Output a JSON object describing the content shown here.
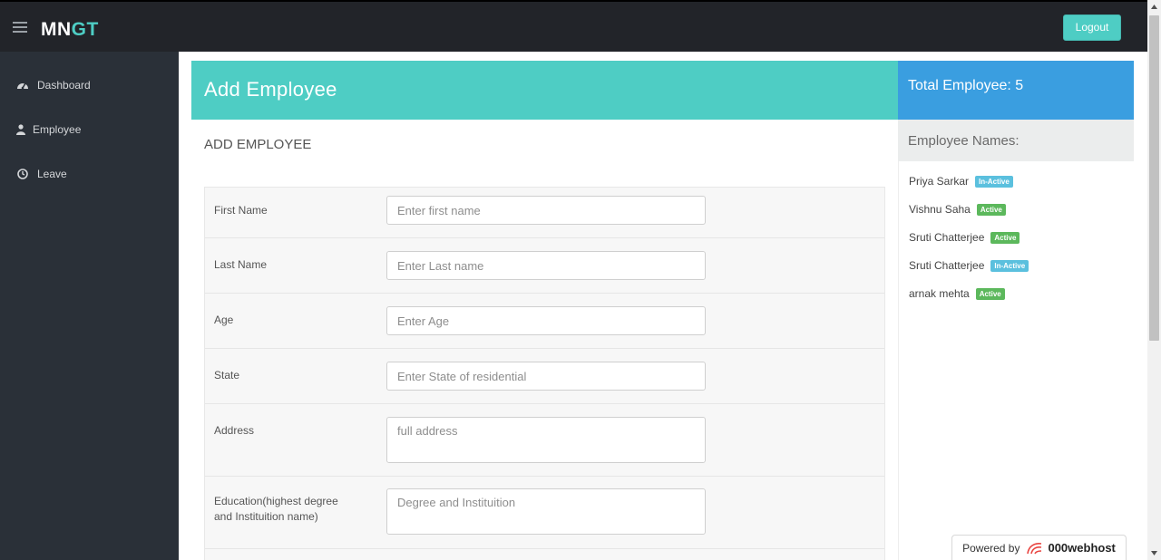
{
  "topbar": {
    "brand_part1": "MN",
    "brand_part2": "GT",
    "logout_label": "Logout",
    "menu_icon": "hamburger-menu-icon"
  },
  "sidebar": {
    "items": [
      {
        "label": "Dashboard",
        "icon": "dashboard-gauge-icon"
      },
      {
        "label": "Employee",
        "icon": "user-icon"
      },
      {
        "label": "Leave",
        "icon": "clock-icon"
      }
    ]
  },
  "main": {
    "header_title": "Add Employee",
    "subtitle": "ADD EMPLOYEE",
    "form": {
      "first_name": {
        "label": "First Name",
        "placeholder": "Enter first name"
      },
      "last_name": {
        "label": "Last Name",
        "placeholder": "Enter Last name"
      },
      "age": {
        "label": "Age",
        "placeholder": "Enter Age"
      },
      "state": {
        "label": "State",
        "placeholder": "Enter State of residential"
      },
      "address": {
        "label": "Address",
        "placeholder": "full address"
      },
      "education": {
        "label_line1": "Education(highest degree",
        "label_line2": "and Instituition name)",
        "placeholder": "Degree and Instituition"
      }
    }
  },
  "right_panel": {
    "total_label": "Total Employee: 5",
    "names_title": "Employee Names:",
    "employees": [
      {
        "name": "Priya Sarkar",
        "status": "In-Active"
      },
      {
        "name": "Vishnu Saha",
        "status": "Active"
      },
      {
        "name": "Sruti Chatterjee",
        "status": "Active"
      },
      {
        "name": "Sruti Chatterjee",
        "status": "In-Active"
      },
      {
        "name": "arnak mehta",
        "status": "Active"
      }
    ]
  },
  "footer": {
    "powered_label": "Powered by",
    "host_name": "000webhost"
  },
  "colors": {
    "accent_teal": "#4ecdc4",
    "accent_blue": "#3a9ee0",
    "topbar_bg": "#222429",
    "sidebar_bg": "#2a3038",
    "badge_active": "#5cb85c",
    "badge_inactive": "#5bc0de"
  }
}
